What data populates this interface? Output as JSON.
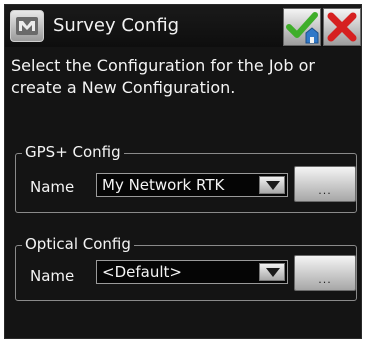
{
  "window": {
    "title": "Survey Config"
  },
  "toolbar": {
    "app_icon": "survey-app-icon",
    "ok_icon": "checkmark-icon",
    "cancel_icon": "close-icon"
  },
  "instructions": "Select the Configuration for the Job or create a New Configuration.",
  "gps_config": {
    "legend": "GPS+ Config",
    "name_label": "Name",
    "selected": "My Network RTK",
    "more_label": "..."
  },
  "optical_config": {
    "legend": "Optical Config",
    "name_label": "Name",
    "selected": "<Default>",
    "more_label": "..."
  },
  "colors": {
    "background": "#141414",
    "text": "#f4f4f4",
    "ok_green": "#3fae2a",
    "cancel_red": "#d62020"
  }
}
